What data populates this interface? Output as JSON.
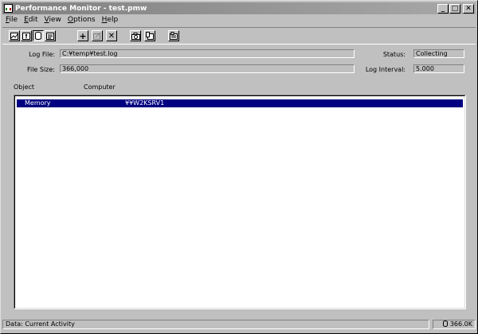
{
  "window": {
    "title": "Performance Monitor - test.pmw"
  },
  "menu": [
    {
      "key": "F",
      "rest": "ile"
    },
    {
      "key": "E",
      "rest": "dit"
    },
    {
      "key": "V",
      "rest": "iew"
    },
    {
      "key": "O",
      "rest": "ptions"
    },
    {
      "key": "H",
      "rest": "elp"
    }
  ],
  "toolbar": {
    "icons": [
      "chart-view-icon",
      "alert-view-icon",
      "log-view-icon",
      "report-view-icon",
      "add-counter-icon",
      "edit-counter-icon",
      "delete-counter-icon",
      "update-now-icon",
      "bookmark-icon",
      "options-icon"
    ],
    "add_glyph": "+",
    "delete_glyph": "✕"
  },
  "info": {
    "log_file_label": "Log File:",
    "log_file_value": "C:¥temp¥test.log",
    "file_size_label": "File Size:",
    "file_size_value": "366,000",
    "status_label": "Status:",
    "status_value": "Collecting",
    "log_interval_label": "Log Interval:",
    "log_interval_value": "5.000"
  },
  "columns": {
    "object": "Object",
    "computer": "Computer"
  },
  "rows": [
    {
      "object": "Memory",
      "computer": "¥¥W2KSRV1"
    }
  ],
  "statusbar": {
    "left": "Data: Current Activity",
    "right": "366.0K"
  },
  "colors": {
    "selection": "#000080",
    "face": "#c0c0c0"
  }
}
